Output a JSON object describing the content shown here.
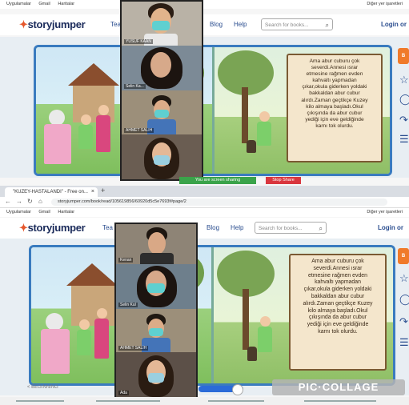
{
  "top": {
    "bookmarks": [
      "Uygulamalar",
      "Gmail",
      "Haritalar"
    ],
    "bookmarks_other": "Diğer yer işaretleri",
    "logo": "storyjumper",
    "nav_fragment": "Tea",
    "nav_blog": "Blog",
    "nav_help": "Help",
    "search_placeholder": "Search for books...",
    "login_fragment": "Login or",
    "participants": [
      "YUSUF KAAN",
      "Selin Ka...",
      "AHMET SALIH",
      ""
    ],
    "story_lines": [
      "Ama abur cuburu çok",
      "severdi.Annesi ısrar",
      "etmesine rağmen evden",
      "kahvaltı yapmadan",
      "çıkar,okula giderken yoldaki",
      "bakkaldan abur cubur",
      "alırdı.Zaman geçtikçe Kuzey",
      "kilo almaya başladı.Okul",
      "çıkışında da abur cubur",
      "yediği için eve geldiğinde",
      "karnı tok olurdu."
    ],
    "share_msg": "You are screen sharing",
    "stop_share": "Stop Share"
  },
  "bottom": {
    "tab_title": "\"KUZEY-HASTALANDI\" - Free on...",
    "tab_close": "×",
    "new_tab": "+",
    "url": "storyjumper.com/book/read/105619856/60920d5c5e7693f#page/2",
    "bookmarks": [
      "Uygulamalar",
      "Gmail",
      "Haritalar"
    ],
    "bookmarks_other": "Diğer yer işaretleri",
    "logo": "storyjumper",
    "nav_fragment": "Tea",
    "nav_blog": "Blog",
    "nav_help": "Help",
    "search_placeholder": "Search for books...",
    "login_fragment": "Login or",
    "participants": [
      "Kenan",
      "Selin Kul",
      "AHMET SALİH",
      "Ada"
    ],
    "story_lines": [
      "Ama abur cuburu çok",
      "severdi.Annesi ısrar",
      "etmesine rağmen evden",
      "kahvaltı yapmadan",
      "çıkar,okula giderken yoldaki",
      "bakkaldan abur cubur",
      "alırdı.Zaman geçtikçe Kuzey",
      "kilo almaya başladı.Okul",
      "çıkışında da abur cubur",
      "yediği için eve geldiğinde",
      "karnı tok olurdu."
    ],
    "begin_label": "< BEGINNING",
    "progress": 0.5
  },
  "watermark": "PIC·COLLAGE",
  "colors": {
    "accent": "#3a7bbf",
    "orange": "#f07a2a",
    "share_green": "#3aa34a",
    "stop_red": "#d9363e"
  },
  "icons": [
    "star-icon",
    "comment-icon",
    "share-icon",
    "list-icon"
  ]
}
